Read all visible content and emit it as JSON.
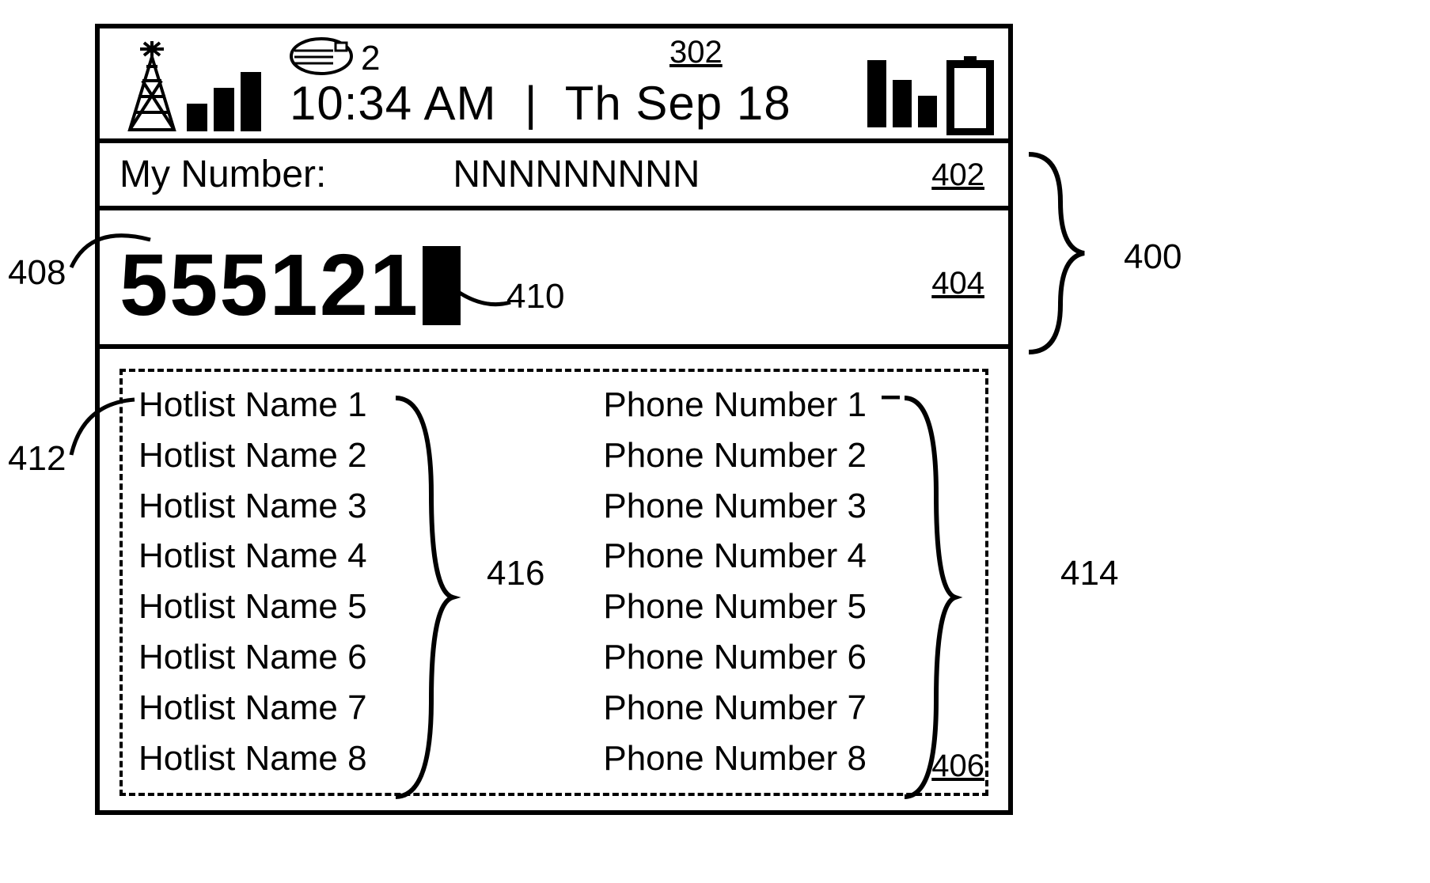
{
  "status": {
    "mail_count": "2",
    "time": "10:34 AM",
    "separator": "|",
    "date": "Th Sep 18"
  },
  "my_number": {
    "label": "My Number:",
    "value": "NNNNNNNNN"
  },
  "dial": {
    "digits": "555121"
  },
  "hotlist": {
    "names": [
      "Hotlist Name 1",
      "Hotlist Name 2",
      "Hotlist Name 3",
      "Hotlist Name 4",
      "Hotlist Name 5",
      "Hotlist Name 6",
      "Hotlist Name 7",
      "Hotlist Name 8"
    ],
    "numbers": [
      "Phone Number 1",
      "Phone Number 2",
      "Phone Number 3",
      "Phone Number 4",
      "Phone Number 5",
      "Phone Number 6",
      "Phone Number 7",
      "Phone Number 8"
    ]
  },
  "callouts": {
    "c302": "302",
    "c400": "400",
    "c402": "402",
    "c404": "404",
    "c406": "406",
    "c408": "408",
    "c410": "410",
    "c412": "412",
    "c414": "414",
    "c416": "416"
  }
}
